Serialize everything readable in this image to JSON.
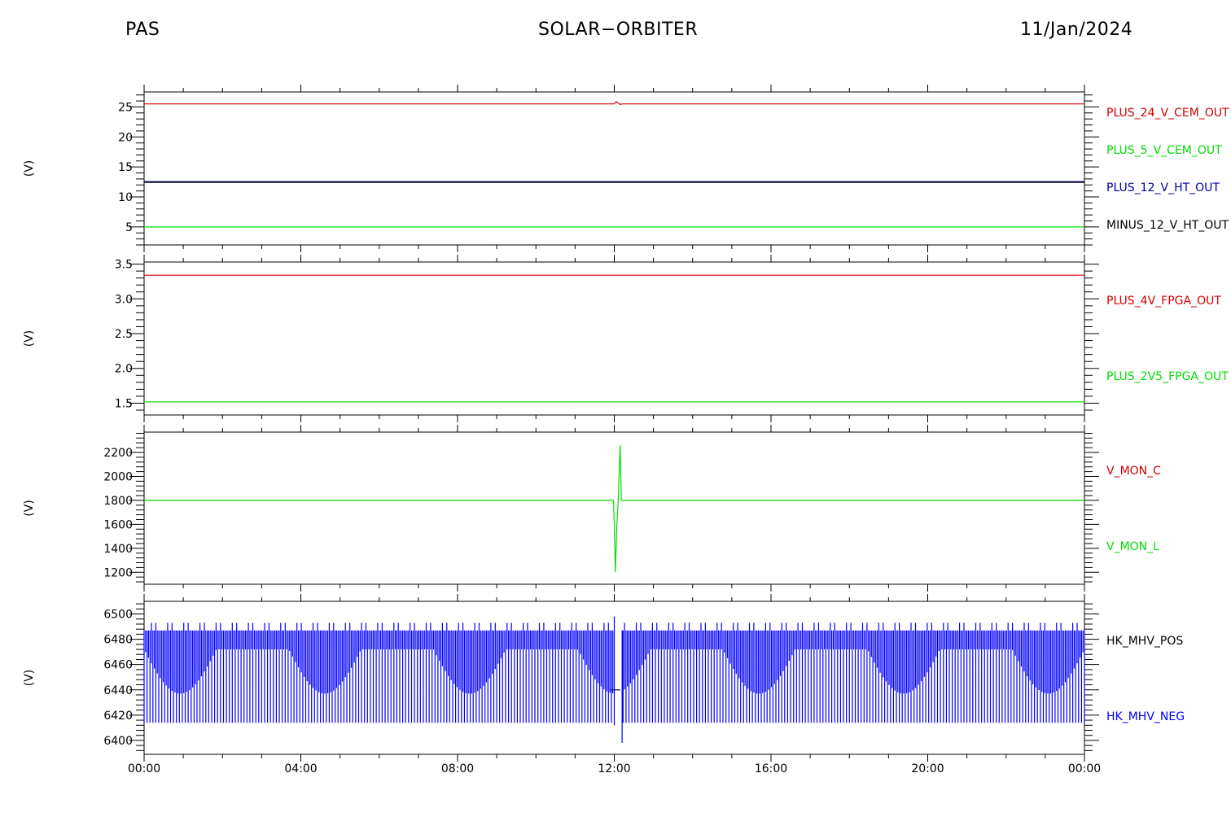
{
  "header": {
    "left": "PAS",
    "center": "SOLAR−ORBITER",
    "right": "11/Jan/2024"
  },
  "chart_data": [
    {
      "type": "line",
      "ylabel": "(V)",
      "ylim": [
        2.0,
        27.5
      ],
      "yticks": [
        5,
        10,
        15,
        20,
        25
      ],
      "xlim": [
        0,
        24
      ],
      "series": [
        {
          "name": "PLUS_24_V_CEM_OUT",
          "color": "#d40000",
          "x": [
            0,
            12.0,
            12.05,
            12.1,
            12.15,
            12.2,
            24
          ],
          "y": [
            25.5,
            25.5,
            25.9,
            25.7,
            25.4,
            25.5,
            25.5
          ]
        },
        {
          "name": "PLUS_5_V_CEM_OUT",
          "color": "#00dd00",
          "x": [
            0,
            24
          ],
          "y": [
            5.0,
            5.0
          ]
        },
        {
          "name": "PLUS_12_V_HT_OUT",
          "color": "#0000a0",
          "x": [
            0,
            24
          ],
          "y": [
            12.5,
            12.5
          ]
        },
        {
          "name": "MINUS_12_V_HT_OUT",
          "color": "#000000",
          "x": [
            0,
            24
          ],
          "y": [
            12.45,
            12.45
          ]
        }
      ]
    },
    {
      "type": "line",
      "ylabel": "(V)",
      "ylim": [
        1.33,
        3.53
      ],
      "yticks": [
        1.5,
        2.0,
        2.5,
        3.0,
        3.5
      ],
      "yticklabels": [
        "1.5",
        "2.0",
        "2.5",
        "3.0",
        "3.5"
      ],
      "xlim": [
        0,
        24
      ],
      "series": [
        {
          "name": "PLUS_4V_FPGA_OUT",
          "color": "#d40000",
          "x": [
            0,
            24
          ],
          "y": [
            3.34,
            3.34
          ]
        },
        {
          "name": "PLUS_2V5_FPGA_OUT",
          "color": "#00dd00",
          "x": [
            0,
            24
          ],
          "y": [
            1.52,
            1.52
          ]
        }
      ]
    },
    {
      "type": "line",
      "ylabel": "(V)",
      "ylim": [
        1100,
        2370
      ],
      "yticks": [
        1200,
        1400,
        1600,
        1800,
        2000,
        2200
      ],
      "xlim": [
        0,
        24
      ],
      "series": [
        {
          "name": "V_MON_C",
          "color": "#d40000",
          "x": [],
          "y": []
        },
        {
          "name": "V_MON_L",
          "color": "#00dd00",
          "x": [
            0,
            11.98,
            12.0,
            12.03,
            12.06,
            12.1,
            12.13,
            12.15,
            12.18,
            12.2,
            24
          ],
          "y": [
            1800,
            1800,
            1600,
            1200,
            1550,
            1800,
            2100,
            2260,
            1800,
            1800,
            1800
          ]
        }
      ]
    },
    {
      "type": "line",
      "ylabel": "(V)",
      "ylim": [
        6389,
        6510
      ],
      "yticks": [
        6400,
        6420,
        6440,
        6460,
        6480,
        6500
      ],
      "xticks": [
        0,
        4,
        8,
        12,
        16,
        20,
        24
      ],
      "xticklabels": [
        "00:00",
        "04:00",
        "08:00",
        "12:00",
        "16:00",
        "20:00",
        "00:00"
      ],
      "xlim": [
        0,
        24
      ],
      "series": [
        {
          "name": "HK_MHV_POS",
          "color": "#000000",
          "x": [
            11.9,
            12.15
          ],
          "y": [
            6440,
            6440
          ]
        },
        {
          "name": "HK_MHV_NEG",
          "color": "#0000ff",
          "x": [],
          "y": [],
          "upper": 6487,
          "lower": 6414
        }
      ]
    }
  ]
}
